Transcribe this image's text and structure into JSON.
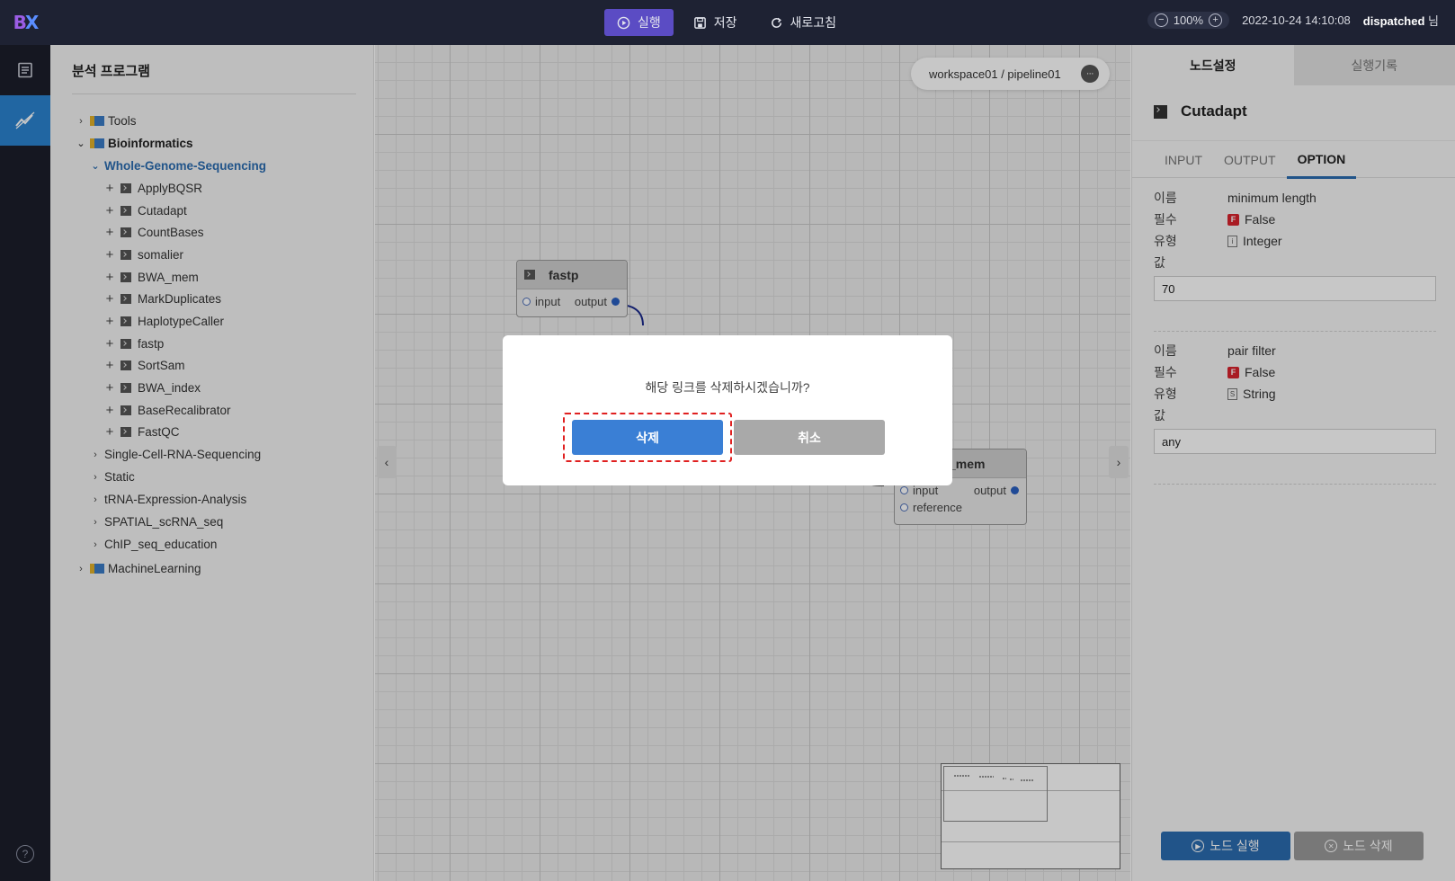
{
  "header": {
    "logo": "BX",
    "actions": [
      {
        "label": "실행",
        "icon": "play-circle-icon"
      },
      {
        "label": "저장",
        "icon": "save-icon"
      },
      {
        "label": "새로고침",
        "icon": "refresh-icon"
      }
    ],
    "zoom": "100%",
    "datetime": "2022-10-24 14:10:08",
    "username": "dispatched",
    "user_suffix": "님"
  },
  "sidebar": {
    "title": "분석 프로그램",
    "tree": {
      "tools": "Tools",
      "bioinformatics": "Bioinformatics",
      "wgs": "Whole-Genome-Sequencing",
      "wgs_items": [
        "ApplyBQSR",
        "Cutadapt",
        "CountBases",
        "somalier",
        "BWA_mem",
        "MarkDuplicates",
        "HaplotypeCaller",
        "fastp",
        "SortSam",
        "BWA_index",
        "BaseRecalibrator",
        "FastQC"
      ],
      "other_groups": [
        "Single-Cell-RNA-Sequencing",
        "Static",
        "tRNA-Expression-Analysis",
        "SPATIAL_scRNA_seq",
        "ChIP_seq_education"
      ],
      "machine_learning": "MachineLearning"
    }
  },
  "canvas": {
    "breadcrumb": "workspace01 / pipeline01",
    "more": "···",
    "nodes": {
      "fastp": {
        "title": "fastp",
        "input": "input",
        "output": "output"
      },
      "bwa_mem": {
        "title": "_mem",
        "input": "input",
        "reference": "reference",
        "output": "output"
      }
    },
    "colors": {
      "link": "#1a2a8c"
    }
  },
  "dialog": {
    "message": "해당 링크를 삭제하시겠습니까?",
    "confirm": "삭제",
    "cancel": "취소"
  },
  "right_panel": {
    "tabs": [
      "노드설정",
      "실행기록"
    ],
    "node_name": "Cutadapt",
    "node_tabs": [
      "INPUT",
      "OUTPUT",
      "OPTION"
    ],
    "labels": {
      "name": "이름",
      "required": "필수",
      "type": "유형",
      "value": "값"
    },
    "options": [
      {
        "name": "minimum length",
        "required_badge": "F",
        "required": "False",
        "type_icon": "i",
        "type": "Integer",
        "value": "70"
      },
      {
        "name": "pair filter",
        "required_badge": "F",
        "required": "False",
        "type_icon": "S",
        "type": "String",
        "value": "any"
      }
    ],
    "buttons": {
      "run": "노드 실행",
      "delete": "노드 삭제"
    }
  }
}
